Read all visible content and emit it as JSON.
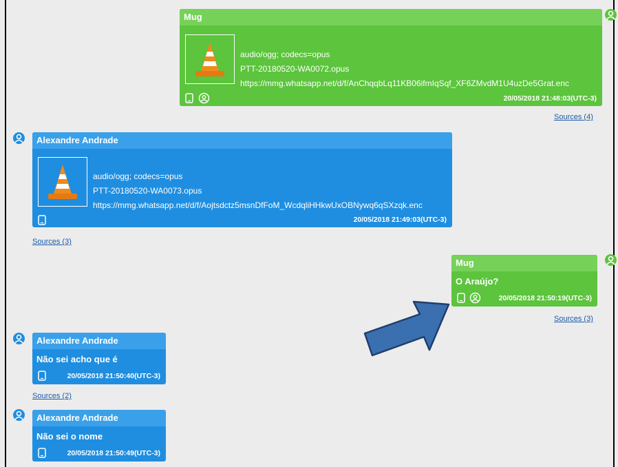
{
  "messages": [
    {
      "sender": "Mug",
      "mime": "audio/ogg; codecs=opus",
      "filename": "PTT-20180520-WA0072.opus",
      "url": "https://mmg.whatsapp.net/d/f/AnChqqbLq11KB06ifmIqSqf_XF6ZMvdM1U4uzDe5Grat.enc",
      "timestamp": "20/05/2018 21:48:03(UTC-3)",
      "sources": "Sources (4)"
    },
    {
      "sender": "Alexandre Andrade",
      "mime": "audio/ogg; codecs=opus",
      "filename": "PTT-20180520-WA0073.opus",
      "url": "https://mmg.whatsapp.net/d/f/Aojtsdctz5msnDfFoM_WcdqliHHkwUxOBNywq6qSXzqk.enc",
      "timestamp": "20/05/2018 21:49:03(UTC-3)",
      "sources": "Sources (3)"
    },
    {
      "sender": "Mug",
      "text": "O Araújo?",
      "timestamp": "20/05/2018 21:50:19(UTC-3)",
      "sources": "Sources (3)"
    },
    {
      "sender": "Alexandre Andrade",
      "text": "Não sei acho que é",
      "timestamp": "20/05/2018 21:50:40(UTC-3)",
      "sources": "Sources (2)"
    },
    {
      "sender": "Alexandre Andrade",
      "text": "Não sei o nome",
      "timestamp": "20/05/2018 21:50:49(UTC-3)"
    }
  ],
  "colors": {
    "outgoing": "#5cc43d",
    "incoming": "#1f8ee0",
    "arrow": "#3a6fb0"
  },
  "icons": [
    "person-avatar-icon",
    "phone-icon",
    "contact-icon",
    "vlc-cone-icon",
    "arrow-annotation"
  ]
}
